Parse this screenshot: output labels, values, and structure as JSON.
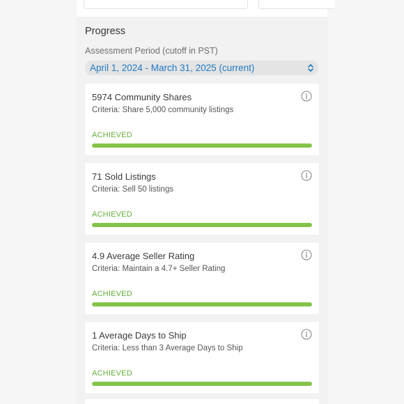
{
  "progress": {
    "title": "Progress",
    "period_label": "Assessment Period (cutoff in PST)",
    "period_value": "April 1, 2024 - March 31, 2025 (current)",
    "colors": {
      "accent": "#1f79c3",
      "achieved": "#63ad3a",
      "bar": "#84c349"
    },
    "cards": [
      {
        "title": "5974 Community Shares",
        "criteria": "Criteria: Share 5,000 community listings",
        "status": "ACHIEVED",
        "progress_fraction": 1.0
      },
      {
        "title": "71 Sold Listings",
        "criteria": "Criteria: Sell 50 listings",
        "status": "ACHIEVED",
        "progress_fraction": 1.0
      },
      {
        "title": "4.9 Average Seller Rating",
        "criteria": "Criteria: Maintain a 4.7+ Seller Rating",
        "status": "ACHIEVED",
        "progress_fraction": 1.0
      },
      {
        "title": "1 Average Days to Ship",
        "criteria": "Criteria: Less than 3 Average Days to Ship",
        "status": "ACHIEVED",
        "progress_fraction": 1.0
      }
    ]
  }
}
